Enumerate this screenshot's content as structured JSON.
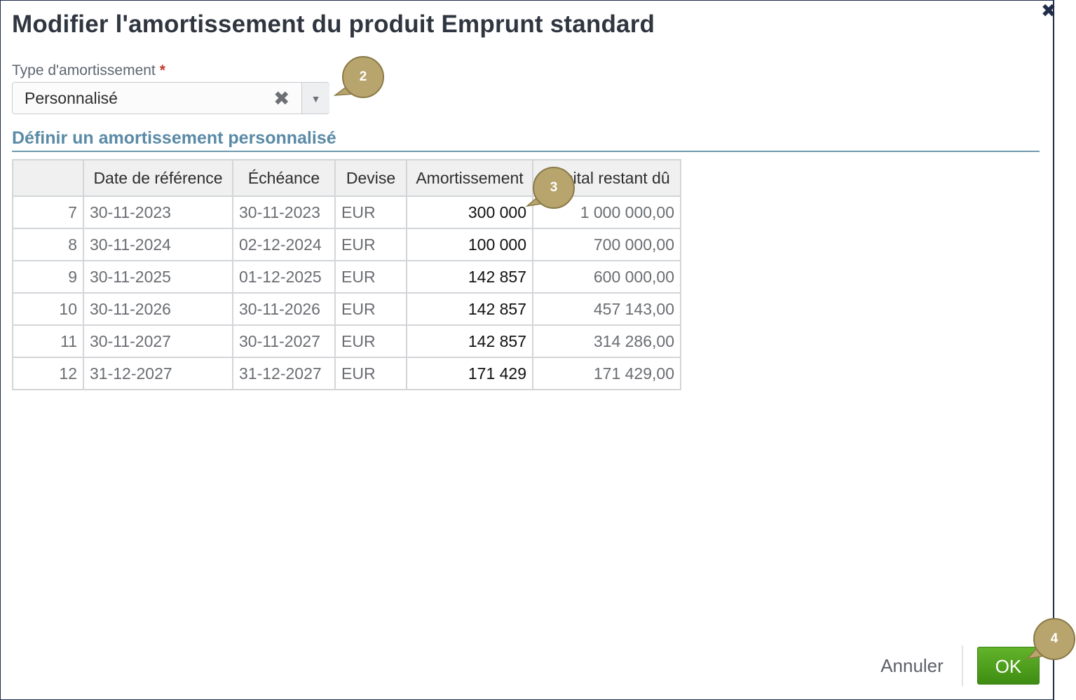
{
  "dialog": {
    "title": "Modifier l'amortissement du produit Emprunt standard",
    "close_icon": "close-icon"
  },
  "amortization_type": {
    "label": "Type d'amortissement",
    "required_marker": "*",
    "value": "Personnalisé",
    "clear_glyph": "✖",
    "dropdown_glyph": "▼"
  },
  "section": {
    "title": "Définir un amortissement personnalisé"
  },
  "table": {
    "headers": [
      "",
      "Date de référence",
      "Échéance",
      "Devise",
      "Amortissement",
      "Capital restant dû"
    ],
    "rows": [
      {
        "num": "7",
        "ref_date": "30-11-2023",
        "due": "30-11-2023",
        "currency": "EUR",
        "amortization": "300 000",
        "capital": "1 000 000,00"
      },
      {
        "num": "8",
        "ref_date": "30-11-2024",
        "due": "02-12-2024",
        "currency": "EUR",
        "amortization": "100 000",
        "capital": "700 000,00"
      },
      {
        "num": "9",
        "ref_date": "30-11-2025",
        "due": "01-12-2025",
        "currency": "EUR",
        "amortization": "142 857",
        "capital": "600 000,00"
      },
      {
        "num": "10",
        "ref_date": "30-11-2026",
        "due": "30-11-2026",
        "currency": "EUR",
        "amortization": "142 857",
        "capital": "457 143,00"
      },
      {
        "num": "11",
        "ref_date": "30-11-2027",
        "due": "30-11-2027",
        "currency": "EUR",
        "amortization": "142 857",
        "capital": "314 286,00"
      },
      {
        "num": "12",
        "ref_date": "31-12-2027",
        "due": "31-12-2027",
        "currency": "EUR",
        "amortization": "171 429",
        "capital": "171 429,00"
      }
    ]
  },
  "callouts": {
    "badge_2": "2",
    "badge_3": "3",
    "badge_4": "4"
  },
  "footer": {
    "cancel_label": "Annuler",
    "ok_label": "OK"
  },
  "colors": {
    "title": "#2f3640",
    "section_title": "#5a8aa6",
    "ok_button": "#4f9e1d",
    "callout": "#b8a46d",
    "dialog_border": "#1f2d4a"
  }
}
